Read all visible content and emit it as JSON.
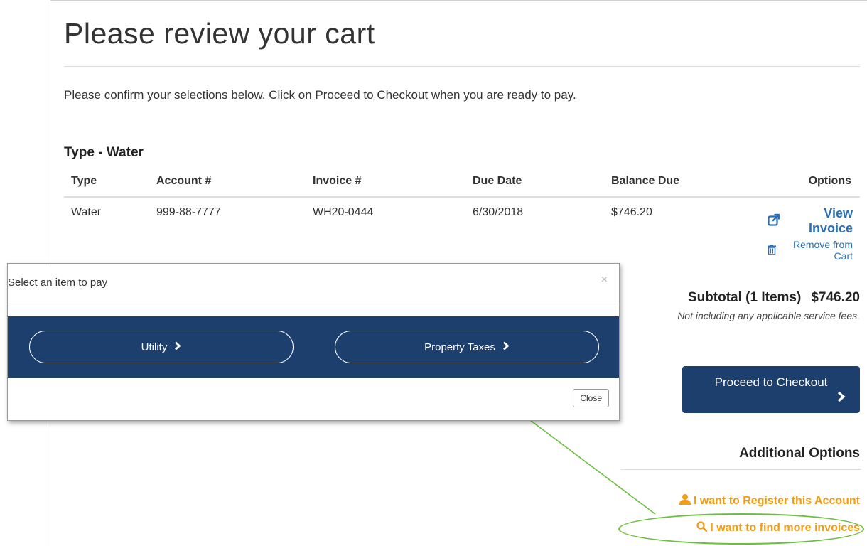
{
  "page": {
    "title": "Please review your cart",
    "intro": "Please confirm your selections below. Click on Proceed to Checkout when you are ready to pay."
  },
  "cart": {
    "section_heading": "Type - Water",
    "columns": [
      "Type",
      "Account #",
      "Invoice #",
      "Due Date",
      "Balance Due",
      "Options"
    ],
    "rows": [
      {
        "type": "Water",
        "account": "999-88-7777",
        "invoice": "WH20-0444",
        "due_date": "6/30/2018",
        "balance": "$746.20",
        "view_invoice_label": "View Invoice",
        "remove_label": "Remove from Cart"
      }
    ]
  },
  "summary": {
    "subtotal_label": "Subtotal (1 Items)",
    "subtotal_value": "$746.20",
    "fees_note": "Not including any applicable service fees.",
    "checkout_label": "Proceed to Checkout"
  },
  "additional_options": {
    "heading": "Additional Options",
    "register_label": "I want to Register this Account",
    "find_label": "I want to find more invoices"
  },
  "modal": {
    "title": "Select an item to pay",
    "close_x": "×",
    "options": [
      "Utility",
      "Property Taxes"
    ],
    "close_label": "Close"
  },
  "colors": {
    "navy": "#1d3f6e",
    "link_blue": "#2a6fb5",
    "orange": "#f39c12",
    "annotation_green": "#6cbf3c"
  },
  "icons": [
    "external-link-icon",
    "trash-icon",
    "chevron-right-icon",
    "user-icon",
    "search-icon"
  ]
}
